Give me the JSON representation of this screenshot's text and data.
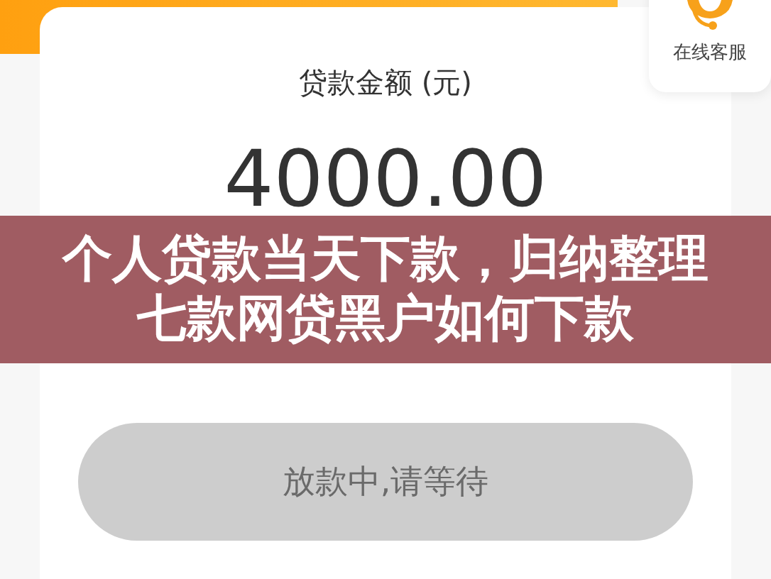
{
  "loan_card": {
    "label": "贷款金额 (元)",
    "amount": "4000.00"
  },
  "service_widget": {
    "label": "在线客服"
  },
  "status_button": {
    "label": "放款中,请等待",
    "disabled": true
  },
  "overlay_title": {
    "lines": [
      "个人贷款当天下款，归纳整理",
      "七款网贷黑户如何下款"
    ]
  }
}
